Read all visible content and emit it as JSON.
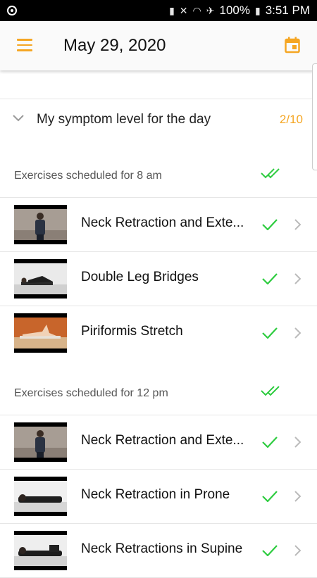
{
  "status_bar": {
    "battery": "100%",
    "time": "3:51 PM"
  },
  "header": {
    "title": "May 29, 2020",
    "menu_icon": "menu-icon",
    "calendar_icon": "calendar-icon"
  },
  "symptom": {
    "label": "My symptom level for the day",
    "level": "2/10"
  },
  "colors": {
    "accent": "#f5a623",
    "check": "#2ecc40"
  },
  "sections": [
    {
      "label": "Exercises scheduled for 8 am",
      "items": [
        {
          "name": "Neck Retraction and Exte...",
          "thumb": "standing-man"
        },
        {
          "name": "Double Leg Bridges",
          "thumb": "lying-bridge"
        },
        {
          "name": "Piriformis Stretch",
          "thumb": "lying-stretch"
        }
      ]
    },
    {
      "label": "Exercises scheduled for 12 pm",
      "items": [
        {
          "name": "Neck Retraction and Exte...",
          "thumb": "standing-man"
        },
        {
          "name": "Neck Retraction in Prone",
          "thumb": "lying-prone"
        },
        {
          "name": "Neck Retractions in Supine",
          "thumb": "lying-supine"
        }
      ]
    }
  ]
}
